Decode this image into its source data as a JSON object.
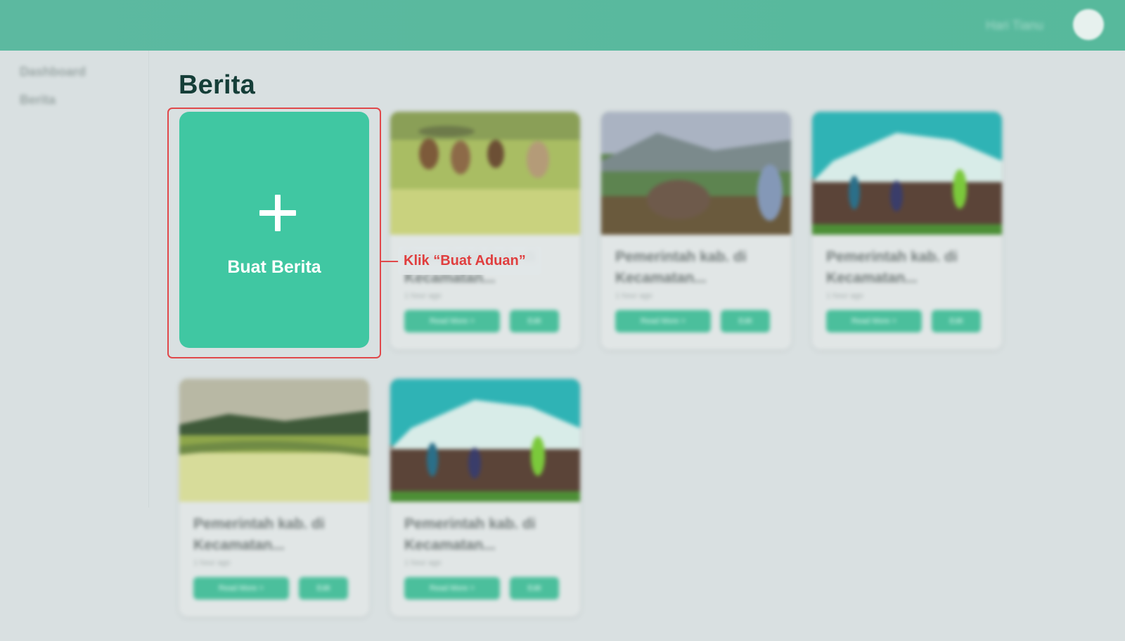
{
  "topbar": {
    "user_name": "Hari Tianu"
  },
  "sidebar": {
    "items": [
      {
        "label": "Dashboard"
      },
      {
        "label": "Berita"
      }
    ]
  },
  "page": {
    "title": "Berita"
  },
  "create_card": {
    "label": "Buat Berita"
  },
  "annotation": {
    "callout": "Klik “Buat Aduan”"
  },
  "news_cards": [
    {
      "title": "Pemerintah kab. di Kecamatan...",
      "date": "1 hour ago",
      "read_more": "Read More >",
      "edit": "Edit"
    },
    {
      "title": "Pemerintah kab. di Kecamatan...",
      "date": "1 hour ago",
      "read_more": "Read More >",
      "edit": "Edit"
    },
    {
      "title": "Pemerintah kab. di Kecamatan...",
      "date": "1 hour ago",
      "read_more": "Read More >",
      "edit": "Edit"
    },
    {
      "title": "Pemerintah kab. di Kecamatan...",
      "date": "1 hour ago",
      "read_more": "Read More >",
      "edit": "Edit"
    },
    {
      "title": "Pemerintah kab. di Kecamatan...",
      "date": "1 hour ago",
      "read_more": "Read More >",
      "edit": "Edit"
    }
  ]
}
